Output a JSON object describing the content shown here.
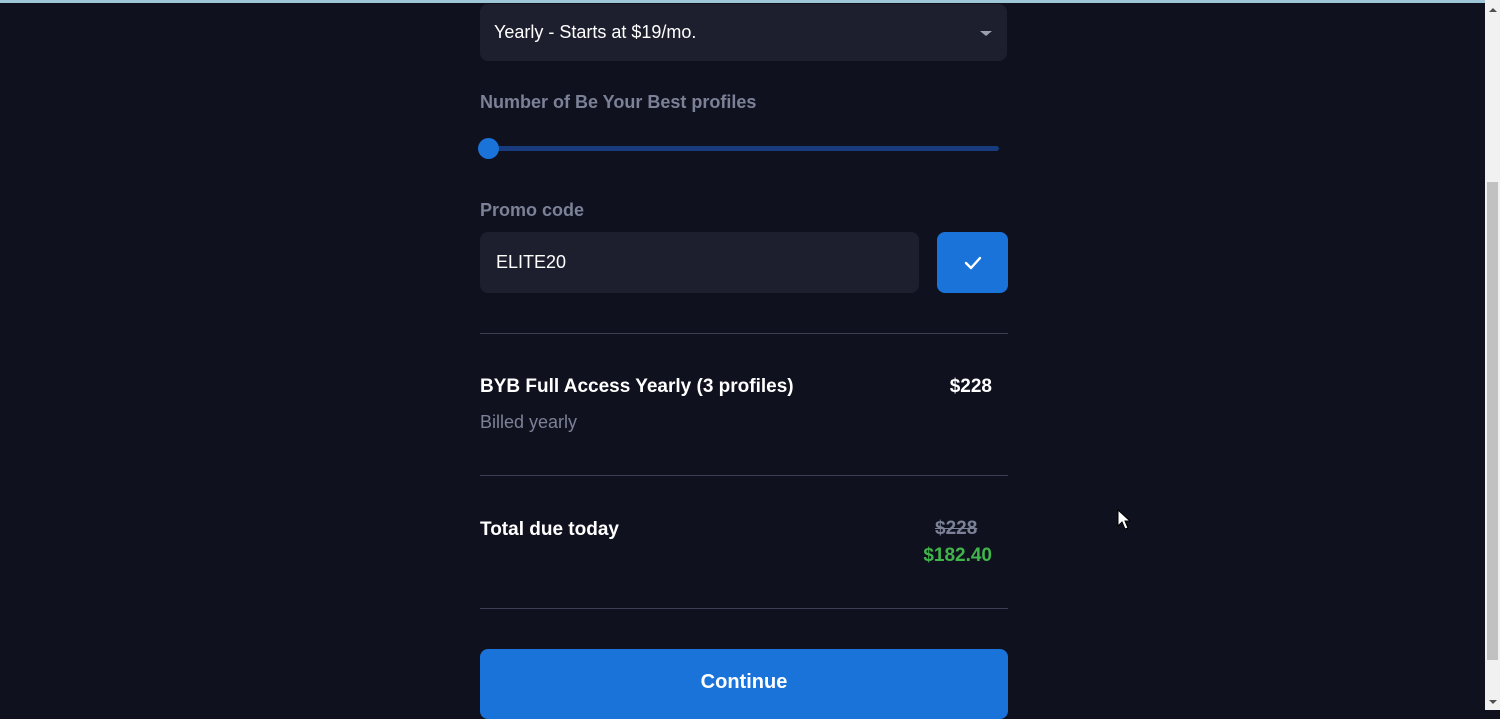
{
  "plan_select": {
    "value": "Yearly - Starts at $19/mo."
  },
  "profiles": {
    "label": "Number of Be Your Best profiles",
    "slider_value": 3,
    "slider_min": 3,
    "slider_max": 10
  },
  "promo": {
    "label": "Promo code",
    "value": "ELITE20"
  },
  "line_item": {
    "title": "BYB Full Access Yearly (3 profiles)",
    "price": "$228",
    "subtitle": "Billed yearly"
  },
  "total": {
    "label": "Total due today",
    "original": "$228",
    "discounted": "$182.40"
  },
  "continue_label": "Continue",
  "icons": {
    "dropdown": "chevron-down-icon",
    "apply": "check-icon",
    "cursor": "mouse-pointer-icon"
  },
  "colors": {
    "background": "#10111f",
    "accent": "#1a73d9",
    "discount": "#3fb54a",
    "muted": "#7b8196",
    "field": "#1d1f2e"
  }
}
